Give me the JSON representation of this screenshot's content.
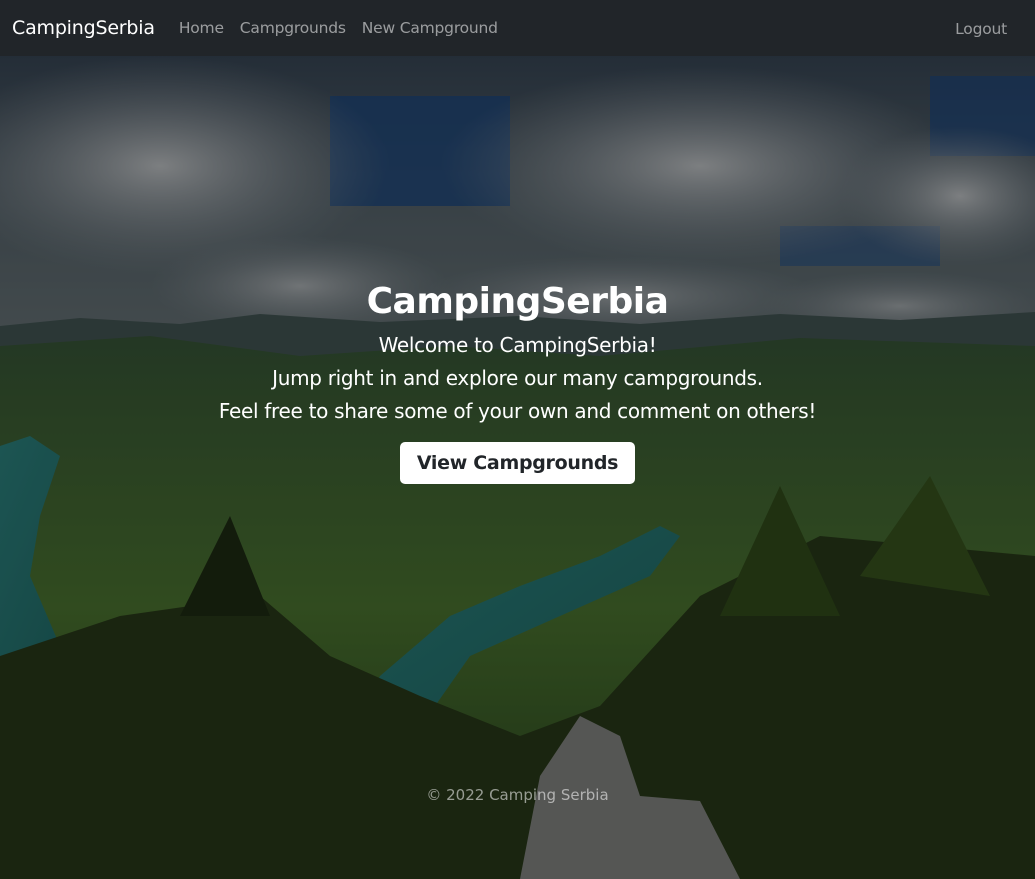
{
  "navbar": {
    "brand": "CampingSerbia",
    "links": [
      {
        "label": "Home"
      },
      {
        "label": "Campgrounds"
      },
      {
        "label": "New Campground"
      }
    ],
    "logout": "Logout"
  },
  "hero": {
    "title": "CampingSerbia",
    "lines": [
      "Welcome to CampingSerbia!",
      "Jump right in and explore our many campgrounds.",
      "Feel free to share some of your own and comment on others!"
    ],
    "button": "View Campgrounds"
  },
  "footer": {
    "text": "© 2022 Camping Serbia"
  },
  "colors": {
    "navbar_bg": "#212529",
    "button_bg": "#ffffff",
    "text": "#ffffff"
  }
}
